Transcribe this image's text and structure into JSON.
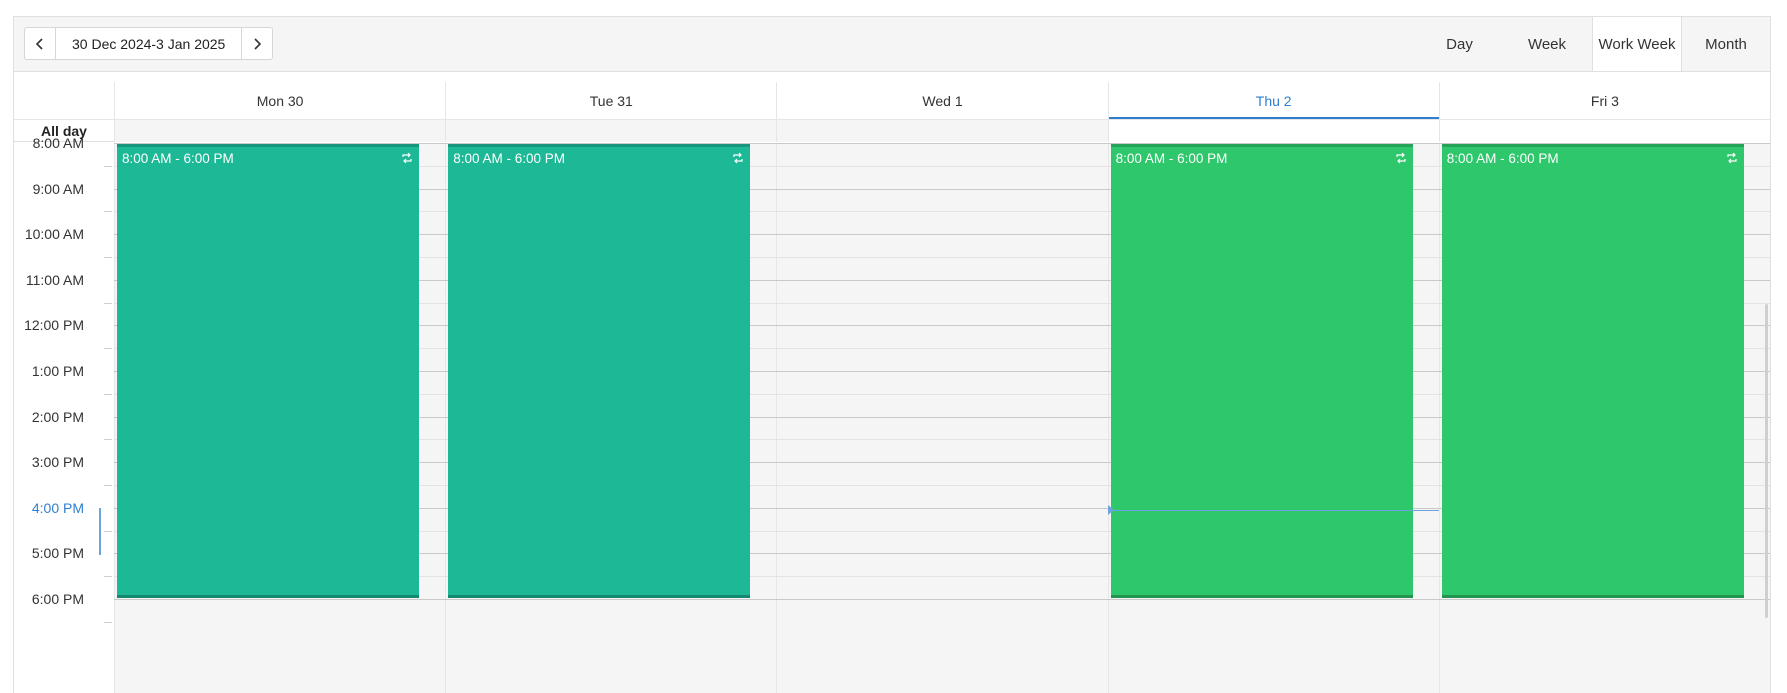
{
  "toolbar": {
    "date_range": "30 Dec 2024-3 Jan 2025",
    "prev_icon": "chevron-left-icon",
    "next_icon": "chevron-right-icon",
    "views": [
      {
        "label": "Day",
        "active": false
      },
      {
        "label": "Week",
        "active": false
      },
      {
        "label": "Work Week",
        "active": true
      },
      {
        "label": "Month",
        "active": false
      }
    ]
  },
  "days": [
    {
      "label": "Mon 30",
      "today": false
    },
    {
      "label": "Tue 31",
      "today": false
    },
    {
      "label": "Wed 1",
      "today": false
    },
    {
      "label": "Thu 2",
      "today": true
    },
    {
      "label": "Fri 3",
      "today": false
    }
  ],
  "all_day_label": "All day",
  "time_slots": [
    "8:00 AM",
    "9:00 AM",
    "10:00 AM",
    "11:00 AM",
    "12:00 PM",
    "1:00 PM",
    "2:00 PM",
    "3:00 PM",
    "4:00 PM",
    "5:00 PM",
    "6:00 PM"
  ],
  "current_time_slot": "4:00 PM",
  "events": [
    {
      "day": 0,
      "time": "8:00 AM - 6:00 PM",
      "recurring": true,
      "color": "#1db896"
    },
    {
      "day": 1,
      "time": "8:00 AM - 6:00 PM",
      "recurring": true,
      "color": "#1db896"
    },
    {
      "day": 3,
      "time": "8:00 AM - 6:00 PM",
      "recurring": true,
      "color": "#2ec76c"
    },
    {
      "day": 4,
      "time": "8:00 AM - 6:00 PM",
      "recurring": true,
      "color": "#2ec76c"
    }
  ],
  "colors": {
    "accent": "#2f7fd0",
    "teal_event": "#1db896",
    "green_event": "#2ec76c"
  }
}
